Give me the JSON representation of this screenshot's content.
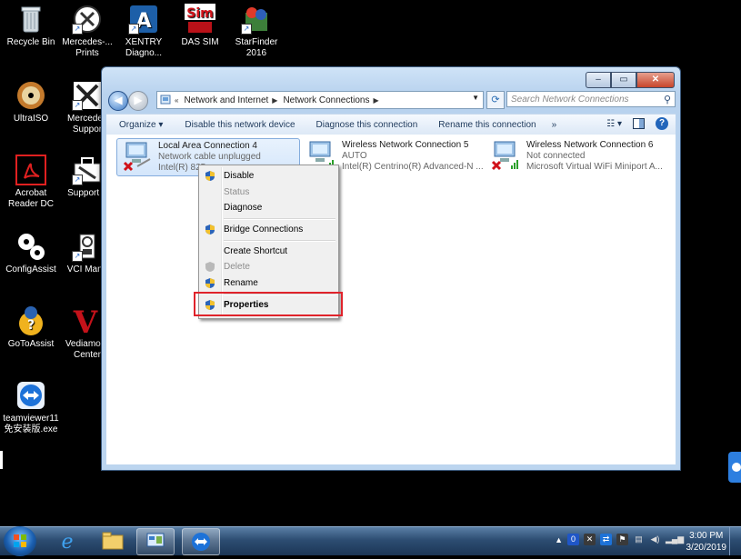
{
  "desktop": {
    "icons": [
      {
        "label": "Recycle Bin"
      },
      {
        "label": "Mercedes-...\nPrints"
      },
      {
        "label": "XENTRY\nDiagno..."
      },
      {
        "label": "DAS SIM"
      },
      {
        "label": "StarFinder\n2016"
      },
      {
        "label": "UltraISO"
      },
      {
        "label": "Mercedes\nSuppor"
      },
      {
        "label": "Acrobat\nReader DC"
      },
      {
        "label": "Support T"
      },
      {
        "label": "ConfigAssist"
      },
      {
        "label": "VCI Mana"
      },
      {
        "label": "GoToAssist"
      },
      {
        "label": "Vediamo S\nCenter"
      },
      {
        "label": "teamviewer11\n免安装版.exe"
      }
    ]
  },
  "window": {
    "breadcrumb": [
      "Network and Internet",
      "Network Connections"
    ],
    "breadcrumb_prefix": "«",
    "search_placeholder": "Search Network Connections",
    "toolbar": [
      "Organize ▾",
      "Disable this network device",
      "Diagnose this connection",
      "Rename this connection",
      "»"
    ],
    "connections": [
      {
        "name": "Local Area Connection 4",
        "status": "Network cable unplugged",
        "device": "Intel(R) 825"
      },
      {
        "name": "Wireless Network Connection 5",
        "status": "AUTO",
        "device": "Intel(R) Centrino(R) Advanced-N ..."
      },
      {
        "name": "Wireless Network Connection 6",
        "status": "Not connected",
        "device": "Microsoft Virtual WiFi Miniport A..."
      }
    ]
  },
  "context_menu": {
    "items": {
      "disable": "Disable",
      "status": "Status",
      "diagnose": "Diagnose",
      "bridge": "Bridge Connections",
      "shortcut": "Create Shortcut",
      "delete": "Delete",
      "rename": "Rename",
      "properties": "Properties"
    }
  },
  "taskbar": {
    "time": "3:00 PM",
    "date": "3/20/2019",
    "tray_arrow": "▲"
  },
  "colors": {
    "highlight_box": "#e0232b",
    "window_frame": "#bcd5ef"
  }
}
